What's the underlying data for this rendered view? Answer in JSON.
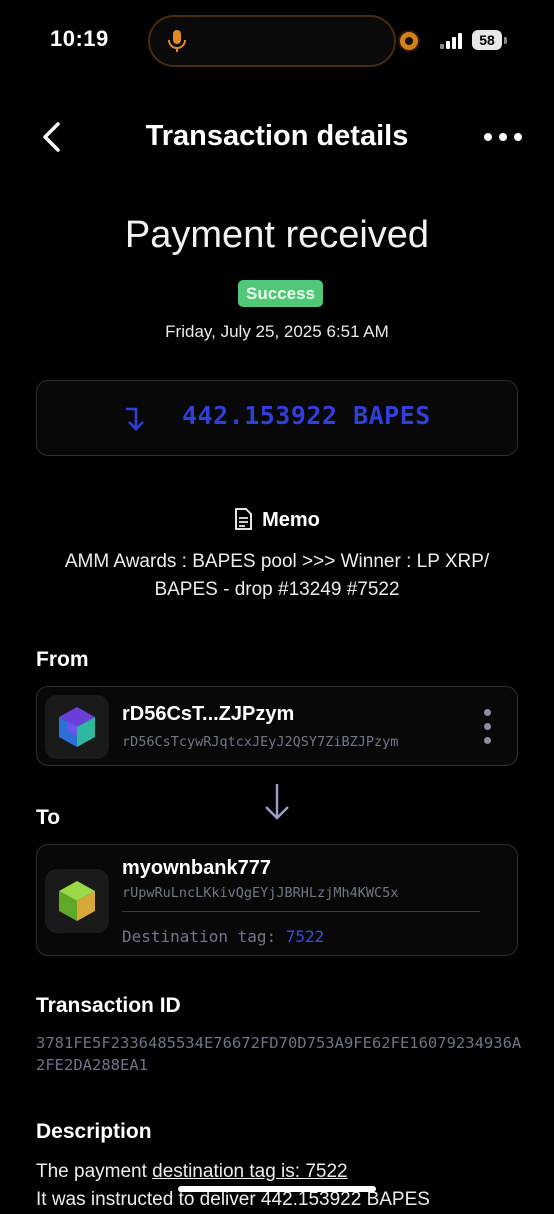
{
  "status_bar": {
    "time": "10:19",
    "battery": "58"
  },
  "nav": {
    "title": "Transaction details"
  },
  "summary": {
    "headline": "Payment received",
    "status": "Success",
    "date": "Friday, July 25, 2025 6:51 AM",
    "amount": "442.153922 BAPES"
  },
  "memo": {
    "label": "Memo",
    "text": "AMM Awards : BAPES pool >>> Winner : LP XRP/ BAPES - drop #13249 #7522"
  },
  "from": {
    "label": "From",
    "name": "rD56CsT...ZJPzym",
    "address": "rD56CsTcywRJqtcxJEyJ2QSY7ZiBZJPzym"
  },
  "to": {
    "label": "To",
    "name": "myownbank777",
    "address": "rUpwRuLncLKkivQgEYjJBRHLzjMh4KWC5x",
    "dest_label": "Destination tag:",
    "dest_tag": "7522"
  },
  "txid": {
    "label": "Transaction ID",
    "value": "3781FE5F2336485534E76672FD70D753A9FE62FE16079234936A2FE2DA288EA1"
  },
  "description": {
    "label": "Description",
    "line1_prefix": "The payment ",
    "line1_underlined": "destination tag is: 7522",
    "line2": "It was instructed to deliver 442.153922 BAPES"
  },
  "colors": {
    "accent": "#2f3fd8",
    "success": "#50c878",
    "muted": "#6d7488"
  }
}
